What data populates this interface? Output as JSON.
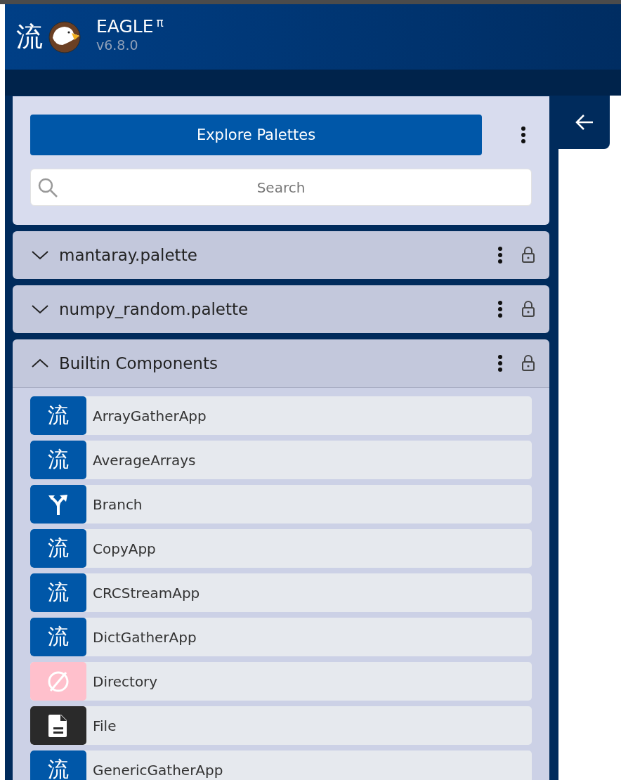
{
  "header": {
    "logo_glyph": "流",
    "title": "EAGLE",
    "title_superscript": "π",
    "version": "v6.8.0"
  },
  "palette_panel": {
    "explore_button": "Explore Palettes",
    "search": {
      "placeholder": "Search"
    },
    "palettes": [
      {
        "name": "mantaray.palette",
        "expanded": false,
        "locked": true
      },
      {
        "name": "numpy_random.palette",
        "expanded": false,
        "locked": true
      },
      {
        "name": "Builtin Components",
        "expanded": true,
        "locked": true,
        "components": [
          {
            "name": "ArrayGatherApp",
            "kind": "glyph",
            "glyph": "流"
          },
          {
            "name": "AverageArrays",
            "kind": "glyph",
            "glyph": "流"
          },
          {
            "name": "Branch",
            "kind": "branch"
          },
          {
            "name": "CopyApp",
            "kind": "glyph",
            "glyph": "流"
          },
          {
            "name": "CRCStreamApp",
            "kind": "glyph",
            "glyph": "流"
          },
          {
            "name": "DictGatherApp",
            "kind": "glyph",
            "glyph": "流"
          },
          {
            "name": "Directory",
            "kind": "directory"
          },
          {
            "name": "File",
            "kind": "file"
          },
          {
            "name": "GenericGatherApp",
            "kind": "glyph",
            "glyph": "流"
          }
        ]
      }
    ]
  }
}
